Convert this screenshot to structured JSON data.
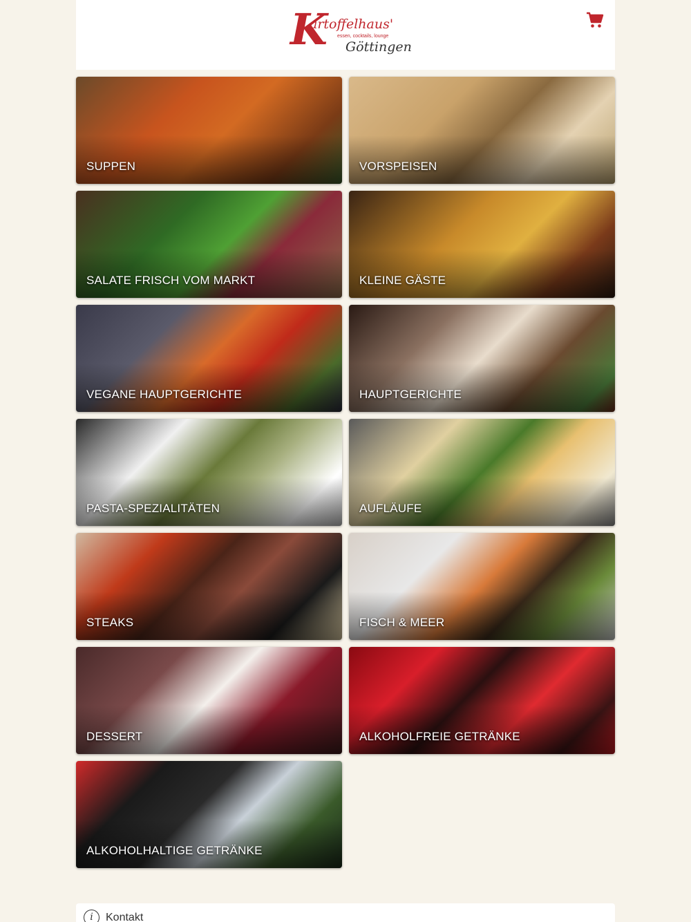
{
  "header": {
    "logo": {
      "letter": "K",
      "name": "artoffelhaus'",
      "tagline": "essen, cocktails, lounge",
      "city": "Göttingen"
    },
    "cart_icon": "shopping-cart-icon",
    "cart_color": "#c0262d"
  },
  "categories": [
    {
      "label": "SUPPEN",
      "image": "soup-photo",
      "bg": "linear-gradient(135deg,#6b4a2a 0%,#c8541e 35%,#d36a22 55%,#7a3b16 80%,#3a5a2a 100%)"
    },
    {
      "label": "VORSPEISEN",
      "image": "hummus-photo",
      "bg": "linear-gradient(135deg,#d9b98a 0%,#c9a26a 35%,#8a6a40 55%,#e4d2b2 75%,#b8a06e 100%)"
    },
    {
      "label": "SALATE FRISCH VOM MARKT",
      "image": "salad-photo",
      "bg": "linear-gradient(135deg,#4a3020 0%,#2f6a24 35%,#4fa034 55%,#8a2a3a 70%,#8c6b4a 100%)"
    },
    {
      "label": "KLEINE GÄSTE",
      "image": "fish-and-chips-photo",
      "bg": "linear-gradient(135deg,#3a2414 0%,#c88a2a 40%,#e0b040 60%,#7a3a1a 80%,#2a1a10 100%)"
    },
    {
      "label": "VEGANE HAUPTGERICHTE",
      "image": "pasta-salad-photo",
      "bg": "linear-gradient(135deg,#3a3a4a 0%,#5a5a6a 30%,#d86a2a 50%,#c02a1a 65%,#4a6a2a 85%,#2a2a3a 100%)"
    },
    {
      "label": "HAUPTGERICHTE",
      "image": "grilled-fish-photo",
      "bg": "linear-gradient(135deg,#2a1a14 0%,#8a7060 30%,#e8dccc 50%,#6a4a30 70%,#4a7a3a 90%,#6a2a1a 100%)"
    },
    {
      "label": "PASTA-SPEZIALITÄTEN",
      "image": "pesto-pasta-photo",
      "bg": "linear-gradient(135deg,#2a2a2a 0%,#f0f0f0 30%,#6a7a3a 50%,#a8b080 65%,#ffffff 85%,#c0c0c0 100%)"
    },
    {
      "label": "AUFLÄUFE",
      "image": "casserole-photo",
      "bg": "linear-gradient(135deg,#5a5a5a 0%,#e0d0a0 30%,#4a7a2a 50%,#e8c070 65%,#f0e8d0 85%,#8a8a8a 100%)"
    },
    {
      "label": "STEAKS",
      "image": "steak-photo",
      "bg": "linear-gradient(135deg,#d0b8a0 0%,#c03a1a 25%,#4a2418 45%,#8a4a3a 60%,#1a1a1a 80%,#d8c8a0 100%)"
    },
    {
      "label": "FISCH & MEER",
      "image": "salmon-photo",
      "bg": "linear-gradient(135deg,#d8d0c8 0%,#e8e8e8 30%,#d87a3a 50%,#3a2a1a 65%,#6a8a3a 80%,#c8c8c8 100%)"
    },
    {
      "label": "DESSERT",
      "image": "sundae-photo",
      "bg": "linear-gradient(135deg,#4a2a2a 0%,#7a4a4a 30%,#f4f0ec 50%,#8a1a2a 70%,#3a1a1a 100%)"
    },
    {
      "label": "ALKOHOLFREIE GETRÄNKE",
      "image": "cola-bottles-photo",
      "bg": "linear-gradient(135deg,#8a0a12 0%,#d81e2a 25%,#2a1010 45%,#e02a30 65%,#3a1414 85%,#c01a20 100%)"
    },
    {
      "label": "ALKOHOLHALTIGE GETRÄNKE",
      "image": "champagne-photo",
      "bg": "linear-gradient(135deg,#d02a2a 0%,#1a1a1a 25%,#2a2a2a 45%,#c8d0d8 60%,#3a5a2a 80%,#1a2a1a 100%)"
    }
  ],
  "footer": {
    "icon": "info-icon",
    "info_glyph": "i",
    "contact_label": "Kontakt"
  }
}
